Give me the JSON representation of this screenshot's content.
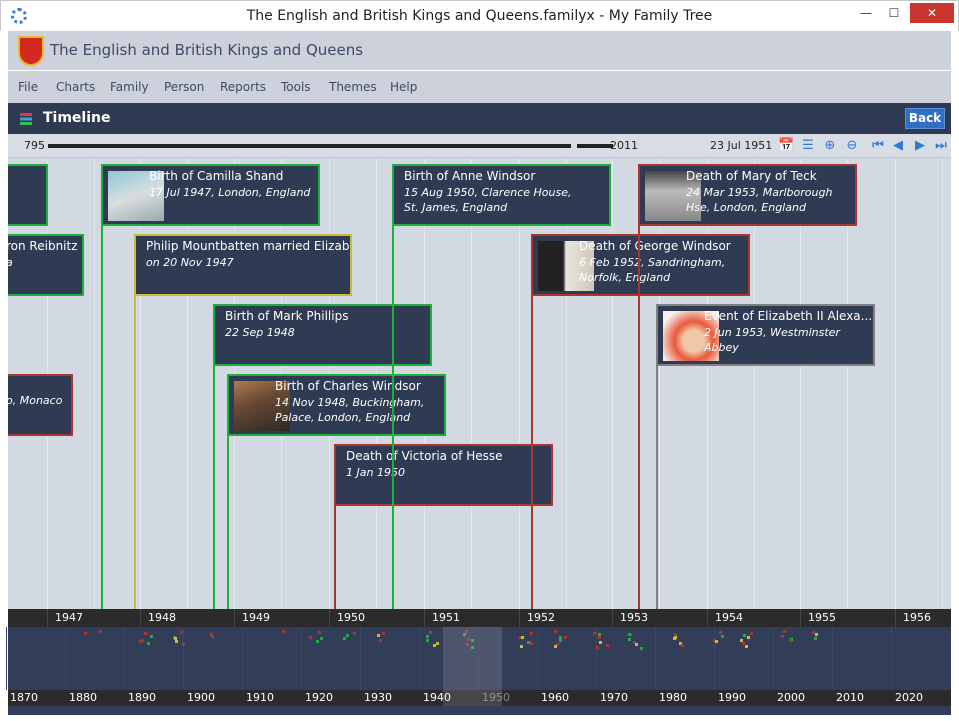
{
  "window": {
    "title": "The English and British Kings and Queens.familyx - My Family Tree",
    "minimize": "—",
    "maximize": "☐",
    "close": "✕"
  },
  "app": {
    "title": "The English and British Kings and Queens"
  },
  "menu": [
    "File",
    "Charts",
    "Family",
    "Person",
    "Reports",
    "Tools",
    "Themes",
    "Help"
  ],
  "timeline": {
    "title": "Timeline",
    "back_label": "Back",
    "range_min": "795",
    "range_max": "2011",
    "current_date": "23 Jul 1951",
    "toolbar": [
      {
        "icon": "calendar-search-icon",
        "glyph": "📅"
      },
      {
        "icon": "timeline-filter-icon",
        "glyph": "☰"
      },
      {
        "icon": "zoom-in-icon",
        "glyph": "⊕"
      },
      {
        "icon": "zoom-out-icon",
        "glyph": "⊖"
      },
      {
        "icon": "first-icon",
        "glyph": "⏮"
      },
      {
        "icon": "previous-icon",
        "glyph": "◀"
      },
      {
        "icon": "next-icon",
        "glyph": "▶"
      },
      {
        "icon": "last-icon",
        "glyph": "⏭"
      }
    ]
  },
  "colors": {
    "birth": "#1fae3c",
    "marriage": "#c8bd3a",
    "death": "#a8372f",
    "event": "#808080"
  },
  "events": [
    {
      "title": "",
      "subtitle": "",
      "type": "birth"
    },
    {
      "title": "ron Reibnitz",
      "subtitle": "a",
      "type": "birth"
    },
    {
      "title": "Birth of Camilla Shand",
      "subtitle": "17 Jul 1947, London, England",
      "type": "birth",
      "photo": true
    },
    {
      "title": "Philip Mountbatten married Elizabet...",
      "subtitle": "on 20 Nov 1947",
      "type": "marriage"
    },
    {
      "title": "Birth of Mark Phillips",
      "subtitle": "22 Sep 1948",
      "type": "birth"
    },
    {
      "title": "Birth of Charles Windsor",
      "subtitle": "14 Nov 1948, Buckingham, Palace, London, England",
      "type": "birth",
      "photo": true
    },
    {
      "title": "",
      "subtitle": "o, Monaco",
      "type": "death"
    },
    {
      "title": "Death of Victoria of Hesse",
      "subtitle": "1 Jan 1950",
      "type": "death"
    },
    {
      "title": "Birth of Anne Windsor",
      "subtitle": "15 Aug 1950, Clarence House, St. James, England",
      "type": "birth"
    },
    {
      "title": "Death of George Windsor",
      "subtitle": "6 Feb 1952, Sandringham, Norfolk, England",
      "type": "death",
      "photo": true
    },
    {
      "title": "Death of Mary of Teck",
      "subtitle": "24 Mar 1953, Marlborough Hse, London, England",
      "type": "death",
      "photo": true
    },
    {
      "title": "Event of Elizabeth II Alexa...",
      "subtitle": "2 Jun 1953, Westminster Abbey",
      "type": "event",
      "photo": true
    }
  ],
  "axis_years": [
    "1947",
    "1948",
    "1949",
    "1950",
    "1951",
    "1952",
    "1953",
    "1954",
    "1955",
    "1956"
  ],
  "overview_decades": [
    "1870",
    "1880",
    "1890",
    "1900",
    "1910",
    "1920",
    "1930",
    "1940",
    "1950",
    "1960",
    "1970",
    "1980",
    "1990",
    "2000",
    "2010",
    "2020"
  ]
}
